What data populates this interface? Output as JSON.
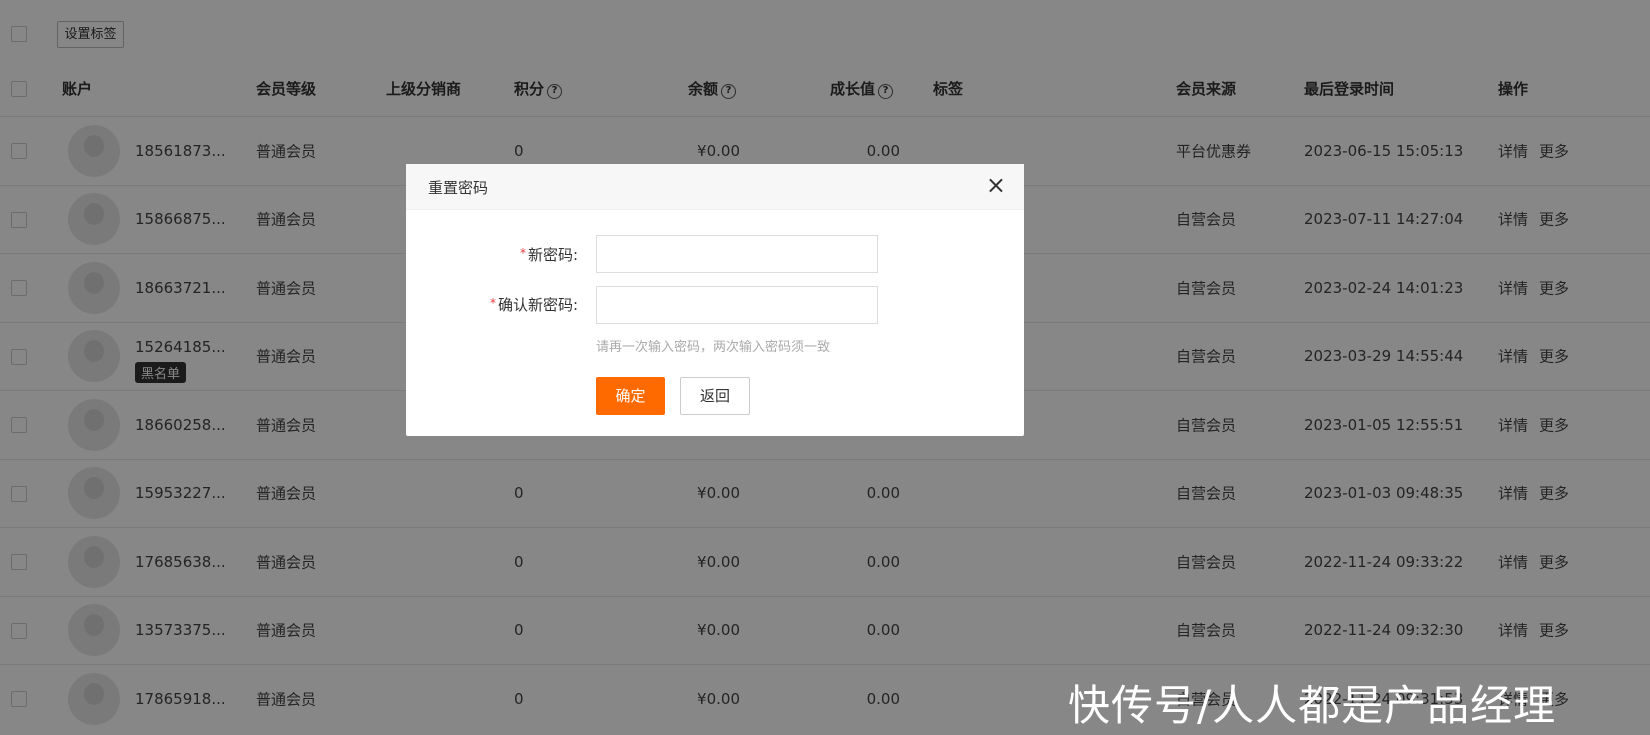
{
  "toolbar": {
    "set_tag_label": "设置标签"
  },
  "columns": {
    "account": "账户",
    "level": "会员等级",
    "distributor": "上级分销商",
    "points": "积分",
    "balance": "余额",
    "growth": "成长值",
    "tags": "标签",
    "source": "会员来源",
    "last_login": "最后登录时间",
    "actions": "操作",
    "help_glyph": "?"
  },
  "actions": {
    "detail": "详情",
    "more": "更多"
  },
  "rows": [
    {
      "account": "18561873...",
      "level": "普通会员",
      "points": "0",
      "balance": "¥0.00",
      "growth": "0.00",
      "source": "平台优惠券",
      "last_login": "2023-06-15 15:05:13",
      "badge": ""
    },
    {
      "account": "15866875...",
      "level": "普通会员",
      "points": "",
      "balance": "",
      "growth": "",
      "source": "自营会员",
      "last_login": "2023-07-11 14:27:04",
      "badge": ""
    },
    {
      "account": "18663721...",
      "level": "普通会员",
      "points": "",
      "balance": "",
      "growth": "",
      "source": "自营会员",
      "last_login": "2023-02-24 14:01:23",
      "badge": ""
    },
    {
      "account": "15264185...",
      "level": "普通会员",
      "points": "",
      "balance": "",
      "growth": "",
      "source": "自营会员",
      "last_login": "2023-03-29 14:55:44",
      "badge": "黑名单"
    },
    {
      "account": "18660258...",
      "level": "普通会员",
      "points": "",
      "balance": "",
      "growth": "",
      "source": "自营会员",
      "last_login": "2023-01-05 12:55:51",
      "badge": ""
    },
    {
      "account": "15953227...",
      "level": "普通会员",
      "points": "0",
      "balance": "¥0.00",
      "growth": "0.00",
      "source": "自营会员",
      "last_login": "2023-01-03 09:48:35",
      "badge": ""
    },
    {
      "account": "17685638...",
      "level": "普通会员",
      "points": "0",
      "balance": "¥0.00",
      "growth": "0.00",
      "source": "自营会员",
      "last_login": "2022-11-24 09:33:22",
      "badge": ""
    },
    {
      "account": "13573375...",
      "level": "普通会员",
      "points": "0",
      "balance": "¥0.00",
      "growth": "0.00",
      "source": "自营会员",
      "last_login": "2022-11-24 09:32:30",
      "badge": ""
    },
    {
      "account": "17865918...",
      "level": "普通会员",
      "points": "0",
      "balance": "¥0.00",
      "growth": "0.00",
      "source": "自营会员",
      "last_login": "2022-11-24 09:31:53",
      "badge": ""
    }
  ],
  "modal": {
    "title": "重置密码",
    "close_glyph": "×",
    "required_mark": "*",
    "new_password_label": "新密码:",
    "new_password_value": "",
    "confirm_password_label": "确认新密码:",
    "confirm_password_value": "",
    "hint": "请再一次输入密码，两次输入密码须一致",
    "ok_label": "确定",
    "back_label": "返回"
  },
  "watermark": "快传号/人人都是产品经理",
  "colors": {
    "accent": "#ff6a00",
    "price": "#e4393c"
  }
}
